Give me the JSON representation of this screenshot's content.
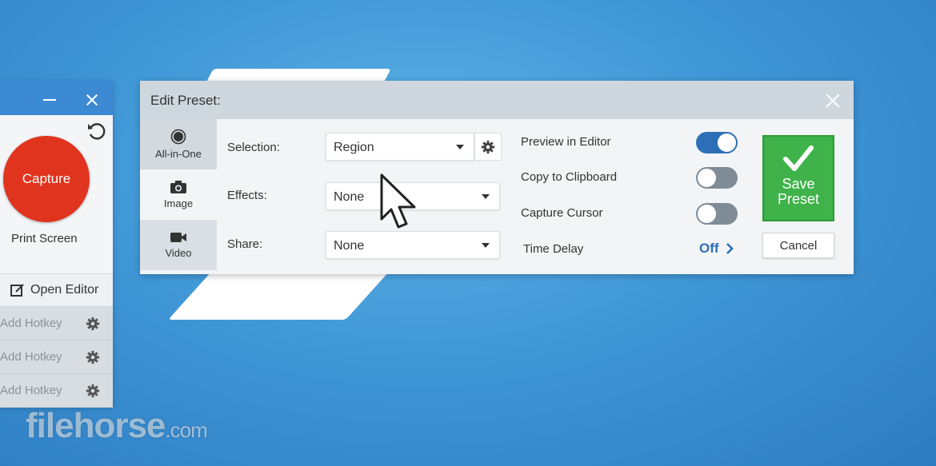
{
  "left_panel": {
    "capture_label": "Capture",
    "print_screen": "Print Screen",
    "open_editor": "Open Editor",
    "hotkeys": [
      "Add Hotkey",
      "Add Hotkey",
      "Add Hotkey"
    ]
  },
  "dialog": {
    "title": "Edit Preset:",
    "tabs": [
      {
        "label": "All-in-One",
        "icon": "all-in-one-icon"
      },
      {
        "label": "Image",
        "icon": "camera-icon"
      },
      {
        "label": "Video",
        "icon": "video-camera-icon"
      }
    ],
    "fields": {
      "selection": {
        "label": "Selection:",
        "value": "Region"
      },
      "effects": {
        "label": "Effects:",
        "value": "None"
      },
      "share": {
        "label": "Share:",
        "value": "None"
      }
    },
    "options": {
      "preview": {
        "label": "Preview in Editor",
        "on": true
      },
      "clipboard": {
        "label": "Copy to Clipboard",
        "on": false
      },
      "cursor": {
        "label": "Capture Cursor",
        "on": false
      },
      "delay": {
        "label": "Time Delay",
        "value": "Off"
      }
    },
    "save_label": "Save Preset",
    "cancel_label": "Cancel"
  },
  "watermark": {
    "main": "filehorse",
    "suffix": ".com"
  },
  "colors": {
    "accent": "#2c6fb6",
    "capture_red": "#e1341e",
    "save_green": "#3fb34a"
  }
}
